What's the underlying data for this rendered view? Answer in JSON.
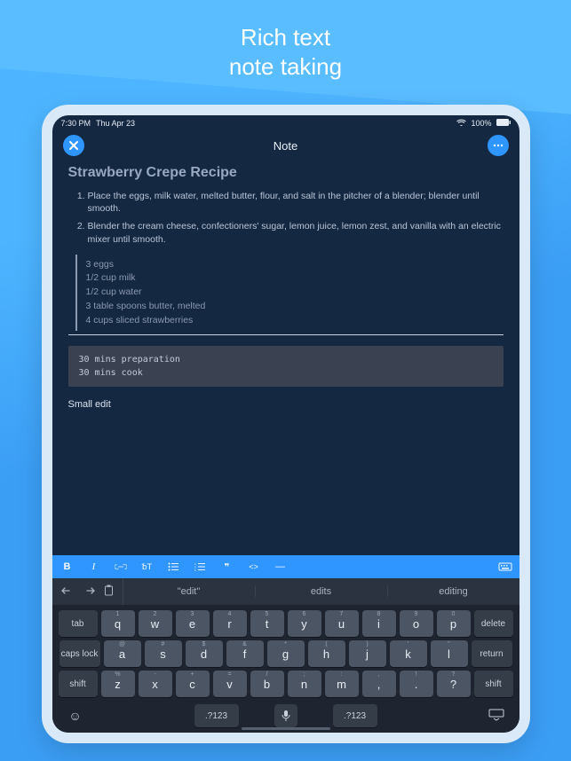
{
  "hero": {
    "line1": "Rich text",
    "line2": "note taking"
  },
  "status": {
    "time": "7:30 PM",
    "date": "Thu Apr 23",
    "battery": "100%"
  },
  "nav": {
    "title": "Note"
  },
  "note": {
    "title": "Strawberry Crepe Recipe",
    "steps": [
      "Place the eggs, milk water, melted butter, flour, and salt in the pitcher of a blender; blender until smooth.",
      "Blender the cream cheese, confectioners' sugar, lemon juice, lemon zest, and vanilla with an electric mixer until smooth."
    ],
    "ingredients": [
      "3 eggs",
      "1/2 cup milk",
      "1/2 cup water",
      "3 table spoons butter, melted",
      "4 cups sliced strawberries"
    ],
    "code": "30 mins preparation\n30 mins cook",
    "small_edit": "Small edit"
  },
  "keyboard": {
    "suggestions": [
      "\"edit\"",
      "edits",
      "editing"
    ],
    "row1": {
      "subs": [
        "1",
        "2",
        "3",
        "4",
        "5",
        "6",
        "7",
        "8",
        "9",
        "0"
      ],
      "keys": [
        "q",
        "w",
        "e",
        "r",
        "t",
        "y",
        "u",
        "i",
        "o",
        "p"
      ],
      "left": "tab",
      "right": "delete"
    },
    "row2": {
      "subs": [
        "@",
        "#",
        "$",
        "&",
        "*",
        "(",
        ")",
        "'",
        "\""
      ],
      "keys": [
        "a",
        "s",
        "d",
        "f",
        "g",
        "h",
        "j",
        "k",
        "l"
      ],
      "left": "caps lock",
      "right": "return"
    },
    "row3": {
      "subs": [
        "%",
        "-",
        "+",
        "=",
        "/",
        ";",
        ":",
        ",",
        "!",
        "?"
      ],
      "keys": [
        "z",
        "x",
        "c",
        "v",
        "b",
        "n",
        "m",
        ",",
        ".",
        "?"
      ],
      "left": "shift",
      "right": "shift"
    },
    "switch": ".?123"
  }
}
